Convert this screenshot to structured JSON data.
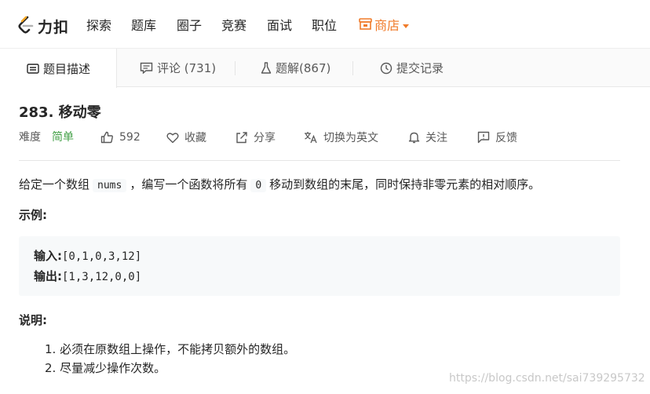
{
  "brand": {
    "name": "力扣",
    "logo_icon": "leetcode-logo-icon",
    "accent": "#f07b2a"
  },
  "nav": {
    "items": [
      "探索",
      "题库",
      "圈子",
      "竞赛",
      "面试",
      "职位"
    ],
    "store_label": "商店"
  },
  "tabs": [
    {
      "label": "题目描述",
      "icon": "description-icon"
    },
    {
      "label": "评论 (731)",
      "icon": "comment-icon"
    },
    {
      "label": "题解(867)",
      "icon": "flask-icon"
    },
    {
      "label": "提交记录",
      "icon": "clock-icon"
    }
  ],
  "problem": {
    "title": "283. 移动零",
    "difficulty_label": "难度",
    "difficulty": "简单",
    "difficulty_color": "#43a047",
    "likes": "592",
    "actions": {
      "favorite": "收藏",
      "share": "分享",
      "switch_lang": "切换为英文",
      "follow": "关注",
      "feedback": "反馈"
    },
    "desc_part1": "给定一个数组",
    "desc_code1": "nums",
    "desc_part2": "，编写一个函数将所有",
    "desc_code2": "0",
    "desc_part3": "移动到数组的末尾，同时保持非零元素的相对顺序。",
    "example_title": "示例:",
    "example": {
      "input_label": "输入:",
      "input_value": "[0,1,0,3,12]",
      "output_label": "输出:",
      "output_value": "[1,3,12,0,0]"
    },
    "notes_title": "说明:",
    "notes": [
      "1. 必须在原数组上操作，不能拷贝额外的数组。",
      "2. 尽量减少操作次数。"
    ]
  },
  "watermark": "https://blog.csdn.net/sai739295732"
}
